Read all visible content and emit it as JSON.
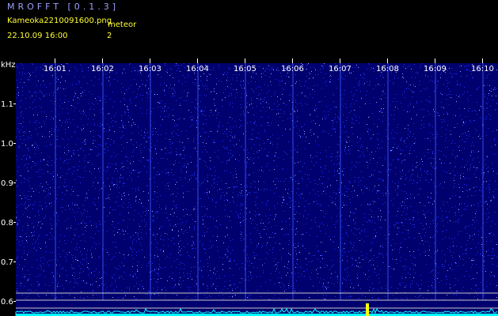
{
  "header": {
    "title": "MROFFT [0.1.3]",
    "filename": "Kameoka2210091600.png",
    "meteor_label": "meteor",
    "timestamp": "22.10.09 16:00",
    "meteor_count": "2"
  },
  "axis": {
    "unit": "kHz",
    "y_ticks": [
      "1.1",
      "1.0",
      "0.9",
      "0.8",
      "0.7",
      "0.6"
    ],
    "x_ticks": [
      "16:01",
      "16:02",
      "16:03",
      "16:04",
      "16:05",
      "16:06",
      "16:07",
      "16:08",
      "16:09",
      "16:10"
    ]
  },
  "colors": {
    "background": "#000000",
    "spectrogram": "#00006e",
    "title": "#9aa0ff",
    "info": "#ffff33",
    "axis": "#ffffff",
    "trace": "#00ffff",
    "meteor": "#ffff00",
    "guide": "#c8c8c8"
  }
}
